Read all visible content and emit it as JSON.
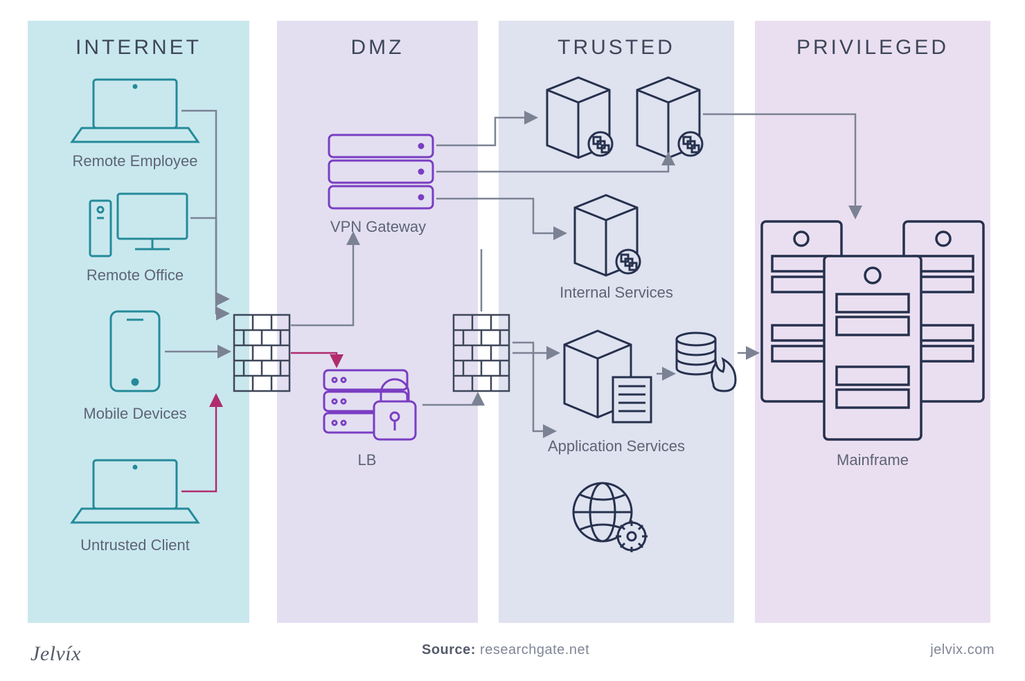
{
  "zones": {
    "internet": "INTERNET",
    "dmz": "DMZ",
    "trusted": "TRUSTED",
    "privileged": "PRIVILEGED"
  },
  "nodes": {
    "remote_employee": "Remote Employee",
    "remote_office": "Remote Office",
    "mobile_devices": "Mobile Devices",
    "untrusted_client": "Untrusted Client",
    "vpn_gateway": "VPN Gateway",
    "lb": "LB",
    "internal_services": "Internal Services",
    "application_services": "Application Services",
    "mainframe": "Mainframe"
  },
  "footer": {
    "brand": "Jelvíx",
    "source_prefix": "Source: ",
    "source": "researchgate.net",
    "site": "jelvix.com"
  },
  "colors": {
    "internet": "#c9e8ee",
    "dmz": "#e3dff1",
    "trusted": "#dfe2ef",
    "privileged": "#eadff0",
    "teal": "#248a99",
    "purple": "#7a3ec2",
    "navy": "#26314e",
    "magenta": "#b02c6d"
  }
}
